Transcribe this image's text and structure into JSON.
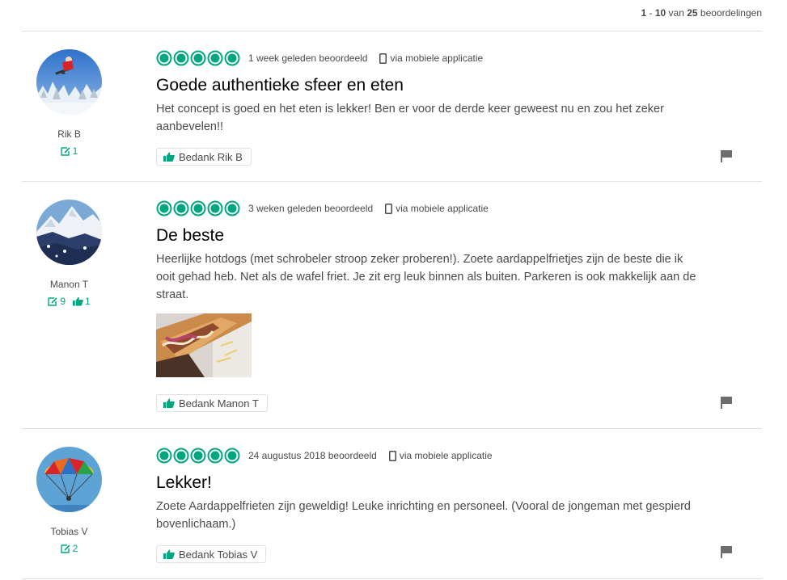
{
  "summary": {
    "range_start": "1",
    "dash": " - ",
    "range_end": "10",
    "of": " van ",
    "total": "25",
    "unit": " beoordelingen"
  },
  "colors": {
    "accent": "#00a680",
    "title": "#000000",
    "text": "#4a4a4a",
    "divider": "#e0e0e0"
  },
  "reviews": [
    {
      "user": "Rik B",
      "contributions": "1",
      "helpful_votes": null,
      "rating": 5,
      "date": "1 week geleden beoordeeld",
      "via": "via mobiele applicatie",
      "title": "Goede authentieke sfeer en eten",
      "text": "Het concept is goed en het eten is lekker! Ben er voor de derde keer geweest nu en zou het zeker aanbevelen!!",
      "thank_label": "Bedank Rik B",
      "avatar_icon": "avatar-skier"
    },
    {
      "user": "Manon T",
      "contributions": "9",
      "helpful_votes": "1",
      "rating": 5,
      "date": "3 weken geleden beoordeeld",
      "via": "via mobiele applicatie",
      "title": "De beste",
      "text": "Heerlijke hotdogs (met schrobeler stroop zeker proberen!). Zoete aardappelfrietjes zijn de beste die ik ooit gehad heb. Net als de wafel friet. Je zit erg leuk binnen als buiten. Parkeren is ook makkelijk aan de straat.",
      "thank_label": "Bedank Manon T",
      "avatar_icon": "avatar-mountains",
      "photo_icon": "hotdog-photo"
    },
    {
      "user": "Tobias V",
      "contributions": "2",
      "helpful_votes": null,
      "rating": 5,
      "date": "24 augustus 2018 beoordeeld",
      "via": "via mobiele applicatie",
      "title": "Lekker!",
      "text": "Zoete Aardappelfrieten zijn geweldig! Leuke inrichting en personeel. (Vooral de jongeman met gespierd bovenlichaam.)",
      "thank_label": "Bedank Tobias V",
      "avatar_icon": "avatar-parasail"
    }
  ]
}
